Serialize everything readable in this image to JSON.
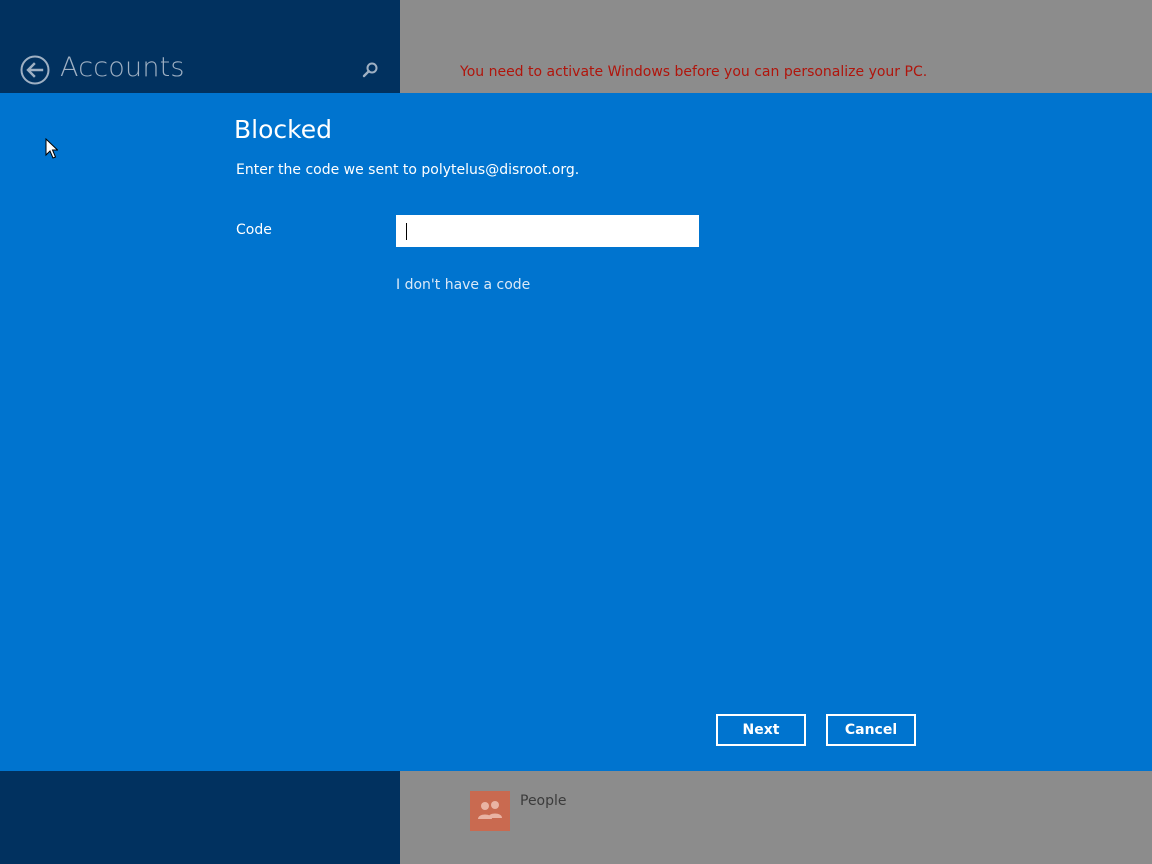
{
  "header": {
    "title": "Accounts",
    "back_icon": "back-arrow-icon",
    "search_icon": "search-icon"
  },
  "activation_warning": "You need to activate Windows before you can personalize your PC.",
  "dialog": {
    "title": "Blocked",
    "subtitle": "Enter the code we sent to polytelus@disroot.org.",
    "code_label": "Code",
    "code_value": "",
    "no_code_link": "I don't have a code",
    "next_label": "Next",
    "cancel_label": "Cancel"
  },
  "background_list": {
    "people_label": "People",
    "people_icon": "people-icon"
  },
  "colors": {
    "dialog_background": "#0074cf",
    "left_pane": "#01315f",
    "right_pane": "#8c8c8c",
    "warning_text": "#b0150c"
  }
}
